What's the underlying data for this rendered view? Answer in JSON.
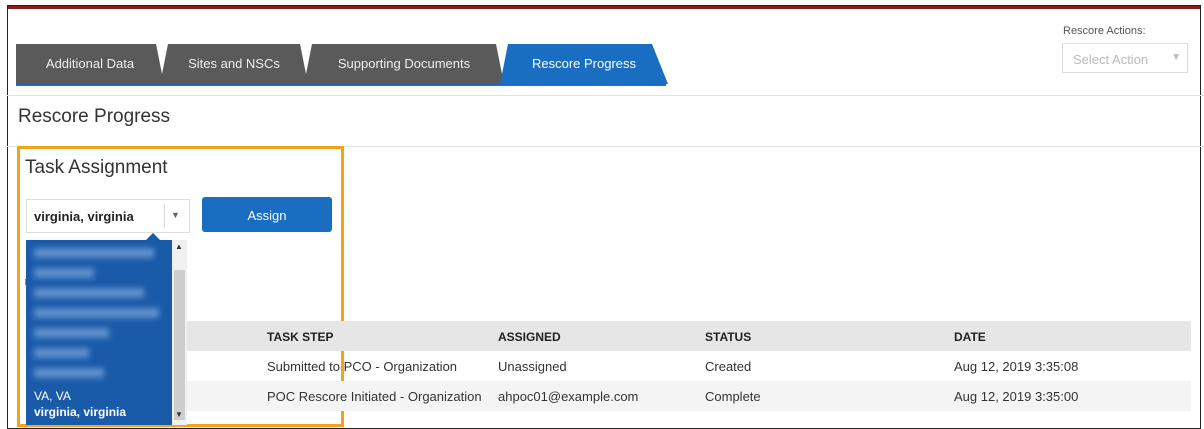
{
  "tabs": [
    {
      "label": "Additional Data",
      "active": false
    },
    {
      "label": "Sites and NSCs",
      "active": false
    },
    {
      "label": "Supporting Documents",
      "active": false
    },
    {
      "label": "Rescore Progress",
      "active": true
    }
  ],
  "rescore_actions": {
    "label": "Rescore Actions:",
    "placeholder": "Select Action"
  },
  "page_title": "Rescore Progress",
  "task_assignment": {
    "title": "Task Assignment",
    "selected_user": "virginia, virginia",
    "assign_label": "Assign",
    "dropdown_options": [
      {
        "label": "",
        "blurred": true
      },
      {
        "label": "",
        "blurred": true
      },
      {
        "label": "",
        "blurred": true
      },
      {
        "label": "",
        "blurred": true
      },
      {
        "label": "",
        "blurred": true
      },
      {
        "label": "",
        "blurred": true
      },
      {
        "label": "",
        "blurred": true
      },
      {
        "label": "VA, VA",
        "blurred": false
      },
      {
        "label": "virginia, virginia",
        "blurred": false,
        "selected": true
      }
    ]
  },
  "table": {
    "headers": [
      "TASK STEP",
      "ASSIGNED",
      "STATUS",
      "DATE"
    ],
    "rows": [
      [
        "Submitted to PCO - Organization",
        "Unassigned",
        "Created",
        "Aug 12, 2019 3:35:08"
      ],
      [
        "POC Rescore Initiated - Organization",
        "ahpoc01@example.com",
        "Complete",
        "Aug 12, 2019 3:35:00"
      ]
    ]
  },
  "colors": {
    "accent": "#1a6ec2",
    "header_bar": "#8b1a1a",
    "highlight": "#f2a21b",
    "tab_inactive": "#5a5a5a"
  }
}
